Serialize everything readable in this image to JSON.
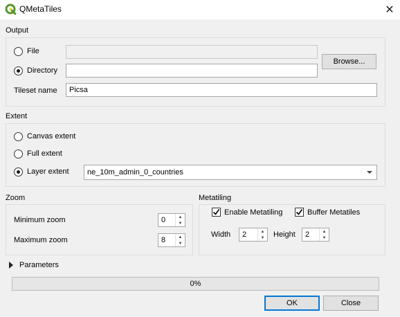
{
  "window": {
    "title": "QMetaTiles",
    "close_glyph": "✕"
  },
  "output": {
    "section_label": "Output",
    "file_label": "File",
    "file_value": "",
    "directory_label": "Directory",
    "directory_value": "",
    "browse_label": "Browse...",
    "tileset_label": "Tileset name",
    "tileset_value": "Picsa"
  },
  "extent": {
    "section_label": "Extent",
    "canvas_label": "Canvas extent",
    "full_label": "Full extent",
    "layer_label": "Layer extent",
    "layer_value": "ne_10m_admin_0_countries"
  },
  "zoom": {
    "section_label": "Zoom",
    "min_label": "Minimum zoom",
    "min_value": "0",
    "max_label": "Maximum zoom",
    "max_value": "8"
  },
  "metatiling": {
    "section_label": "Metatiling",
    "enable_label": "Enable Metatiling",
    "enable_checked": true,
    "buffer_label": "Buffer Metatiles",
    "buffer_checked": true,
    "width_label": "Width",
    "width_value": "2",
    "height_label": "Height",
    "height_value": "2"
  },
  "parameters": {
    "label": "Parameters"
  },
  "progress": {
    "text": "0%",
    "value": 0
  },
  "footer": {
    "ok_label": "OK",
    "close_label": "Close"
  },
  "colors": {
    "qgis_green": "#589632",
    "qgis_yellow": "#f0e130",
    "accent": "#0078d7"
  }
}
